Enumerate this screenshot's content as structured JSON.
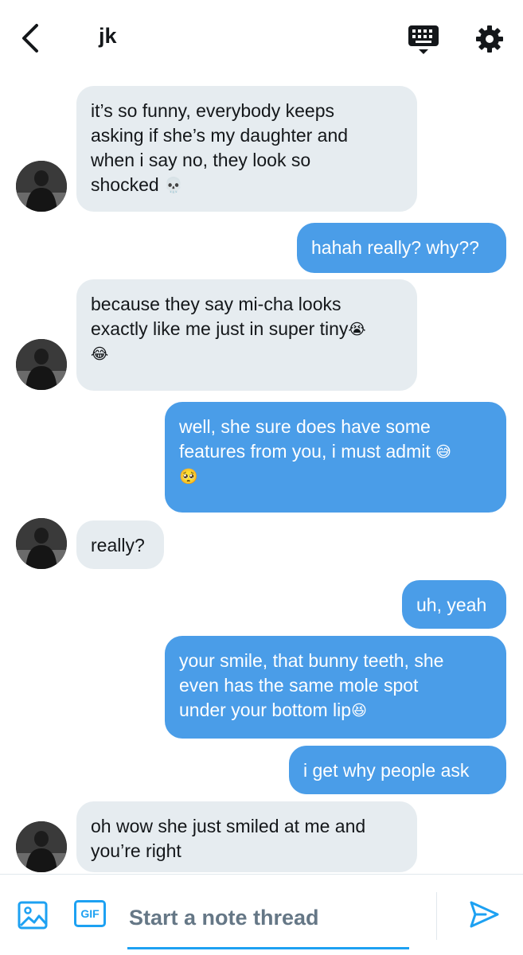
{
  "header": {
    "title": "jk",
    "back_icon": "chevron-left-icon",
    "keyboard_icon": "keyboard-icon",
    "settings_icon": "gear-icon"
  },
  "colors": {
    "incoming_bubble": "#e6ecf0",
    "outgoing_bubble": "#4a9de8",
    "accent": "#1da1f2",
    "placeholder": "#657786"
  },
  "messages": [
    {
      "direction": "in",
      "avatar": true,
      "lines": [
        "it’s so funny, everybody keeps",
        "asking if she’s my daughter and",
        "when i say no, they look so",
        "shocked"
      ],
      "emoji": "💀"
    },
    {
      "direction": "out",
      "lines": [
        "hahah really? why??"
      ]
    },
    {
      "direction": "in",
      "avatar": true,
      "lines": [
        "because they say mi-cha looks",
        "exactly like me just in super tiny"
      ],
      "emoji": "😭",
      "emoji_line": "😂"
    },
    {
      "direction": "out",
      "lines": [
        " well, she sure does have some",
        "features from you, i must admit"
      ],
      "emoji": "😅",
      "emoji_line": "🥺"
    },
    {
      "direction": "in",
      "avatar": true,
      "lines": [
        "really?"
      ]
    },
    {
      "direction": "out",
      "lines": [
        "uh, yeah"
      ]
    },
    {
      "direction": "out",
      "lines": [
        " your smile, that bunny teeth, she",
        "even has the same mole spot",
        "under your bottom lip"
      ],
      "emoji": "😆"
    },
    {
      "direction": "out",
      "lines": [
        "i get why people ask"
      ]
    },
    {
      "direction": "in",
      "avatar": true,
      "lines": [
        "oh wow she just smiled at me and",
        "you’re right"
      ]
    }
  ],
  "composer": {
    "placeholder": "Start a note thread",
    "image_icon": "image-icon",
    "gif_label": "GIF",
    "send_icon": "send-icon"
  }
}
